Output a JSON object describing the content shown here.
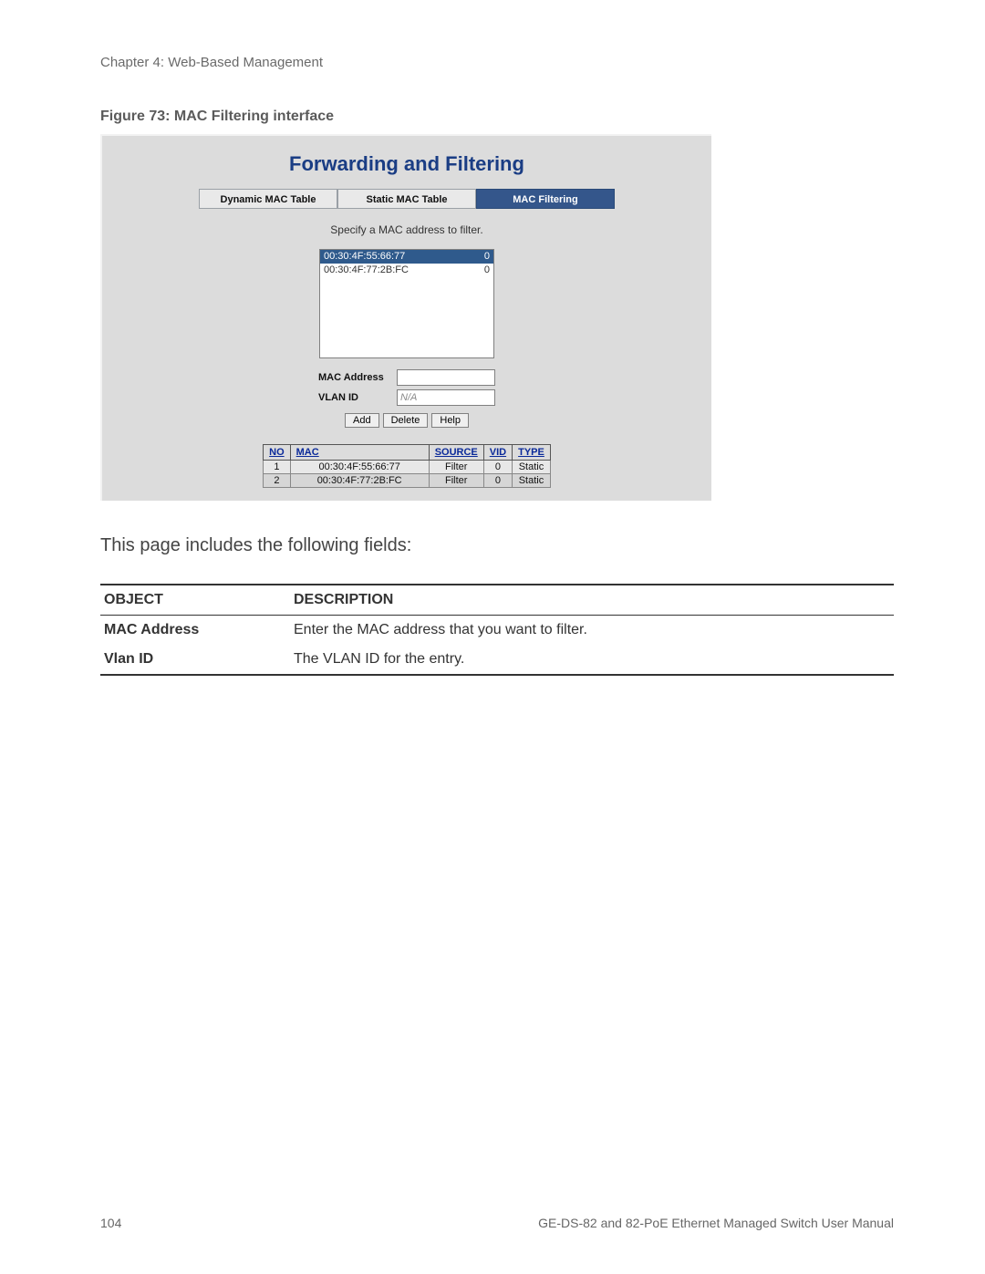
{
  "chapter": "Chapter 4: Web-Based Management",
  "figure_caption": "Figure 73: MAC Filtering interface",
  "shot": {
    "title": "Forwarding and Filtering",
    "tabs": {
      "dynamic": "Dynamic MAC Table",
      "static": "Static MAC Table",
      "filtering": "MAC Filtering"
    },
    "instruction": "Specify a MAC address to filter.",
    "list_rows": [
      {
        "mac": "00:30:4F:55:66:77",
        "vid": "0",
        "selected": true
      },
      {
        "mac": "00:30:4F:77:2B:FC",
        "vid": "0",
        "selected": false
      }
    ],
    "form": {
      "mac_label": "MAC Address",
      "vlan_label": "VLAN ID",
      "vlan_placeholder": "N/A",
      "buttons": {
        "add": "Add",
        "delete": "Delete",
        "help": "Help"
      }
    },
    "result": {
      "headers": {
        "no": "NO",
        "mac": "MAC",
        "source": "SOURCE",
        "vid": "VID",
        "type": "TYPE"
      },
      "rows": [
        {
          "no": "1",
          "mac": "00:30:4F:55:66:77",
          "source": "Filter",
          "vid": "0",
          "type": "Static"
        },
        {
          "no": "2",
          "mac": "00:30:4F:77:2B:FC",
          "source": "Filter",
          "vid": "0",
          "type": "Static"
        }
      ]
    }
  },
  "body_text": "This page includes the following fields:",
  "fields_table": {
    "head": {
      "object": "OBJECT",
      "description": "DESCRIPTION"
    },
    "rows": [
      {
        "object": "MAC Address",
        "description": "Enter the MAC address that you want to filter."
      },
      {
        "object": "Vlan ID",
        "description": "The VLAN ID for the entry."
      }
    ]
  },
  "footer": {
    "page": "104",
    "doc": "GE-DS-82 and 82-PoE Ethernet Managed Switch User Manual"
  }
}
